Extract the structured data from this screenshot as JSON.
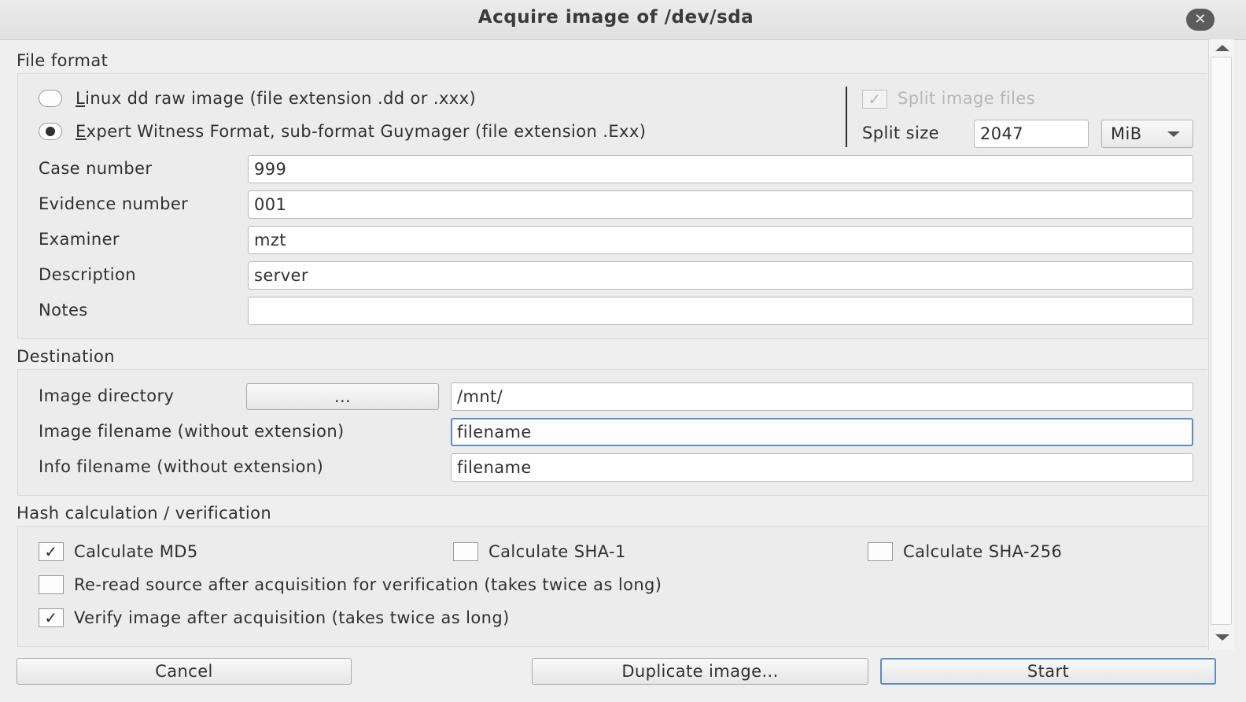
{
  "window": {
    "title": "Acquire image of /dev/sda",
    "close_icon": "✕"
  },
  "file_format": {
    "section_label": "File format",
    "radio_dd": {
      "mnemonic": "L",
      "rest": "inux dd raw image (file extension .dd or .xxx)",
      "selected": false
    },
    "radio_ewf": {
      "mnemonic": "E",
      "rest": "xpert Witness Format, sub-format Guymager (file extension .Exx)",
      "selected": true
    },
    "split_image_files": {
      "label": "Split image files",
      "checked": true,
      "enabled": false
    },
    "split_size": {
      "label": "Split size",
      "value": "2047",
      "unit": "MiB"
    },
    "fields": {
      "case_number": {
        "label": "Case number",
        "value": "999"
      },
      "evidence_number": {
        "label": "Evidence number",
        "value": "001"
      },
      "examiner": {
        "label": "Examiner",
        "value": "mzt"
      },
      "description": {
        "label": "Description",
        "value": "server"
      },
      "notes": {
        "label": "Notes",
        "value": ""
      }
    }
  },
  "destination": {
    "section_label": "Destination",
    "image_directory": {
      "label": "Image directory",
      "browse_label": "...",
      "value": "/mnt/"
    },
    "image_filename": {
      "label": "Image filename (without extension)",
      "value": "filename"
    },
    "info_filename": {
      "label": "Info filename (without extension)",
      "value": "filename"
    }
  },
  "hash": {
    "section_label": "Hash calculation / verification",
    "md5": {
      "label": "Calculate MD5",
      "checked": true
    },
    "sha1": {
      "label": "Calculate SHA-1",
      "checked": false
    },
    "sha256": {
      "label": "Calculate SHA-256",
      "checked": false
    },
    "reread": {
      "label": "Re-read source after acquisition for verification (takes twice as long)",
      "checked": false
    },
    "verify": {
      "label": "Verify image after acquisition (takes twice as long)",
      "checked": true
    }
  },
  "buttons": {
    "cancel": "Cancel",
    "duplicate": "Duplicate image...",
    "start": "Start"
  },
  "check_glyph": "✓"
}
